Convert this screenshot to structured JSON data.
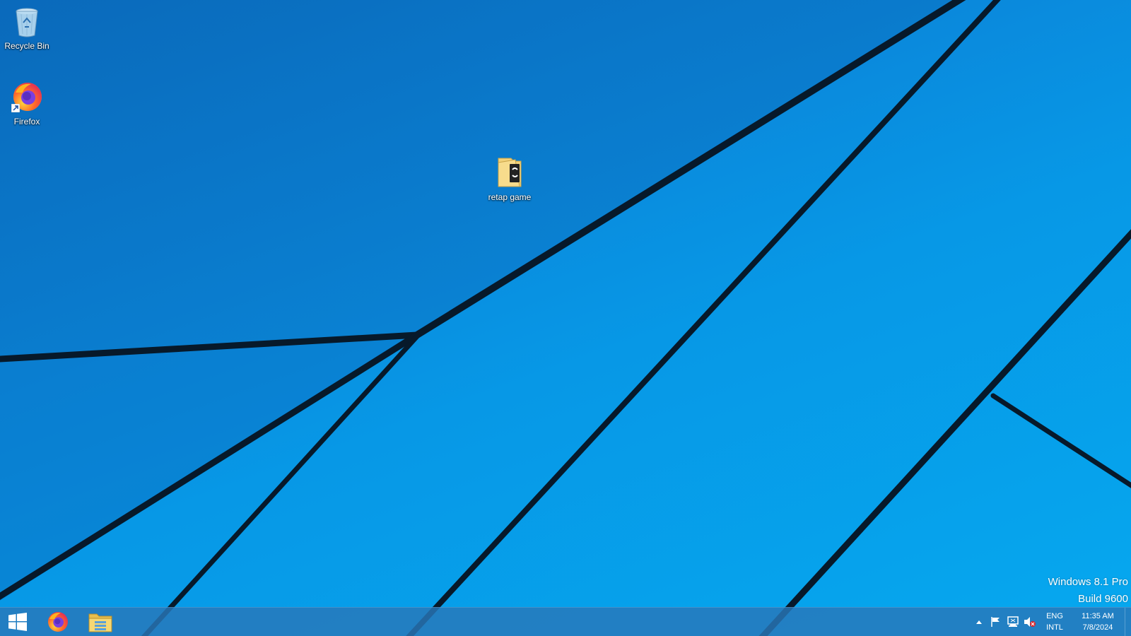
{
  "desktop": {
    "icons": [
      {
        "label": "Recycle Bin",
        "icon": "recycle-bin-icon"
      },
      {
        "label": "Firefox",
        "icon": "firefox-icon"
      },
      {
        "label": "retap game",
        "icon": "folder-icon"
      }
    ]
  },
  "watermark": {
    "line1": "Windows 8.1 Pro",
    "line2": "Build 9600"
  },
  "taskbar": {
    "pinned": [
      {
        "name": "Firefox",
        "icon": "firefox-icon"
      },
      {
        "name": "File Explorer",
        "icon": "file-explorer-icon"
      }
    ],
    "tray": {
      "icons": [
        "chevron-up-icon",
        "flag-icon",
        "network-icon",
        "volume-muted-icon"
      ],
      "lang_line1": "ENG",
      "lang_line2": "INTL",
      "time": "11:35 AM",
      "date": "7/8/2024"
    }
  },
  "colors": {
    "wallpaper_blue": "#0798e6",
    "taskbar": "#2878b9"
  }
}
